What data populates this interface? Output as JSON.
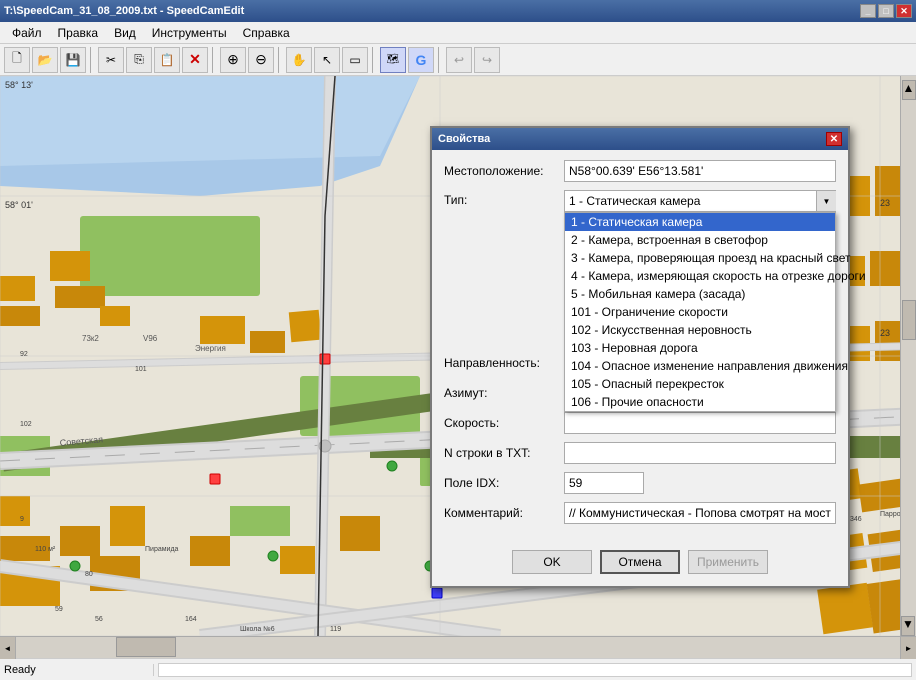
{
  "window": {
    "title": "T:\\SpeedCam_31_08_2009.txt - SpeedCamEdit"
  },
  "menu": {
    "items": [
      {
        "label": "Файл"
      },
      {
        "label": "Правка"
      },
      {
        "label": "Вид"
      },
      {
        "label": "Инструменты"
      },
      {
        "label": "Справка"
      }
    ]
  },
  "toolbar": {
    "buttons": [
      {
        "name": "new",
        "icon": "🗋"
      },
      {
        "name": "open",
        "icon": "📂"
      },
      {
        "name": "save",
        "icon": "💾"
      },
      {
        "name": "sep1",
        "icon": ""
      },
      {
        "name": "cut",
        "icon": "✂"
      },
      {
        "name": "copy",
        "icon": "📋"
      },
      {
        "name": "paste",
        "icon": "📌"
      },
      {
        "name": "delete",
        "icon": "✕"
      },
      {
        "name": "sep2",
        "icon": ""
      },
      {
        "name": "zoom-in",
        "icon": "🔍"
      },
      {
        "name": "zoom-out",
        "icon": "🔎"
      },
      {
        "name": "sep3",
        "icon": ""
      },
      {
        "name": "hand",
        "icon": "✋"
      },
      {
        "name": "cursor",
        "icon": "↖"
      },
      {
        "name": "select",
        "icon": "▭"
      },
      {
        "name": "sep4",
        "icon": ""
      },
      {
        "name": "map",
        "icon": "🗺"
      },
      {
        "name": "google",
        "icon": "G"
      },
      {
        "name": "sep5",
        "icon": ""
      },
      {
        "name": "undo",
        "icon": "↩"
      },
      {
        "name": "redo",
        "icon": "↪"
      }
    ]
  },
  "dialog": {
    "title": "Свойства",
    "location_label": "Местоположение:",
    "location_value": "N58°00.639' E56°13.581'",
    "type_label": "Тип:",
    "type_value": "1 - Статическая камера",
    "direction_label": "Направленность:",
    "direction_value": "",
    "azimuth_label": "Азимут:",
    "azimuth_value": "",
    "speed_label": "Скорость:",
    "speed_value": "",
    "n_row_label": "N строки в TXT:",
    "n_row_value": "",
    "idx_label": "Поле IDX:",
    "idx_value": "59",
    "comment_label": "Комментарий:",
    "comment_value": "// Коммунистическая - Попова смотрят на мост",
    "dropdown_items": [
      {
        "value": "1",
        "label": "1 - Статическая камера",
        "selected": true
      },
      {
        "value": "2",
        "label": "2 - Камера, встроенная в светофор"
      },
      {
        "value": "3",
        "label": "3 - Камера, проверяющая проезд на красный свет"
      },
      {
        "value": "4",
        "label": "4 - Камера, измеряющая скорость на отрезке дороги"
      },
      {
        "value": "5",
        "label": "5 - Мобильная камера (засада)"
      },
      {
        "value": "101",
        "label": "101 - Ограничение скорости"
      },
      {
        "value": "102",
        "label": "102 - Искусственная неровность"
      },
      {
        "value": "103",
        "label": "103 - Неровная дорога"
      },
      {
        "value": "104",
        "label": "104 - Опасное изменение направления движения"
      },
      {
        "value": "105",
        "label": "105 - Опасный перекресток"
      },
      {
        "value": "106",
        "label": "106 - Прочие опасности"
      }
    ],
    "ok_btn": "OK",
    "cancel_btn": "Отмена",
    "apply_btn": "Применить"
  },
  "status": {
    "text": "Ready"
  },
  "map": {
    "coord_label": "58° 13'"
  }
}
